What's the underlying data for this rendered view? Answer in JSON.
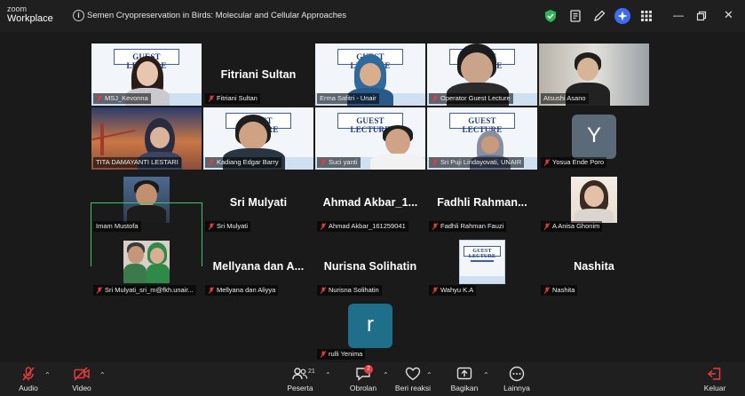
{
  "app": {
    "brand_line1": "zoom",
    "brand_line2": "Workplace"
  },
  "meeting": {
    "title": "Semen Cryopreservation in Birds: Molecular and Cellular Approaches"
  },
  "slide": {
    "banner": "GUEST LECTURE"
  },
  "tiles": {
    "t1": {
      "label": "MSJ_Kevonna"
    },
    "t2": {
      "name": "Fitriani Sultan",
      "label": "Fitriani Sultan"
    },
    "t3": {
      "label": "Erma Safitri - Unair"
    },
    "t4": {
      "label": "Operator Guest Lecture"
    },
    "t5": {
      "label": "Atsushi Asano"
    },
    "t6": {
      "label": "TITA DAMAYANTI LESTARI"
    },
    "t7": {
      "label": "Kadiang Edgar Barry"
    },
    "t8": {
      "label": "Suci yanti"
    },
    "t9": {
      "label": "Sri Puji Lindayovati, UNAIR"
    },
    "t10": {
      "initial": "Y",
      "label": "Yosua Ende Poro"
    },
    "t11": {
      "label": "Imam Mustofa"
    },
    "t12": {
      "name": "Sri Mulyati",
      "label": "Sri Mulyati"
    },
    "t13": {
      "name": "Ahmad Akbar_1...",
      "label": "Ahmad Akbar_161259041"
    },
    "t14": {
      "name": "Fadhli Rahman...",
      "label": "Fadhli Rahman Fauzi"
    },
    "t15": {
      "label": "A Anisa Ghonim"
    },
    "t16": {
      "label": "Sri Mulyati_sri_m@fkh.unair..."
    },
    "t17": {
      "name": "Mellyana dan A...",
      "label": "Mellyana dan Aliyya"
    },
    "t18": {
      "name": "Nurisna Solihatin",
      "label": "Nurisna Solihatin"
    },
    "t19": {
      "label": "Wahyu K.A"
    },
    "t20": {
      "name": "Nashita",
      "label": "Nashita"
    },
    "t21": {
      "initial": "r",
      "label": "rulli Yenima"
    }
  },
  "toolbar": {
    "audio": "Audio",
    "video": "Video",
    "participants": "Peserta",
    "participants_count": "21",
    "chat": "Obrolan",
    "chat_badge": "2",
    "reactions": "Beri reaksi",
    "share": "Bagikan",
    "more": "Lainnya",
    "leave": "Keluar"
  },
  "colors": {
    "accent_green": "#3ec46d",
    "avatar_teal": "#1f6f8b",
    "leave_red": "#e23c3c",
    "mute_red": "#e23c3c",
    "ai_blue": "#3d6cf0"
  }
}
